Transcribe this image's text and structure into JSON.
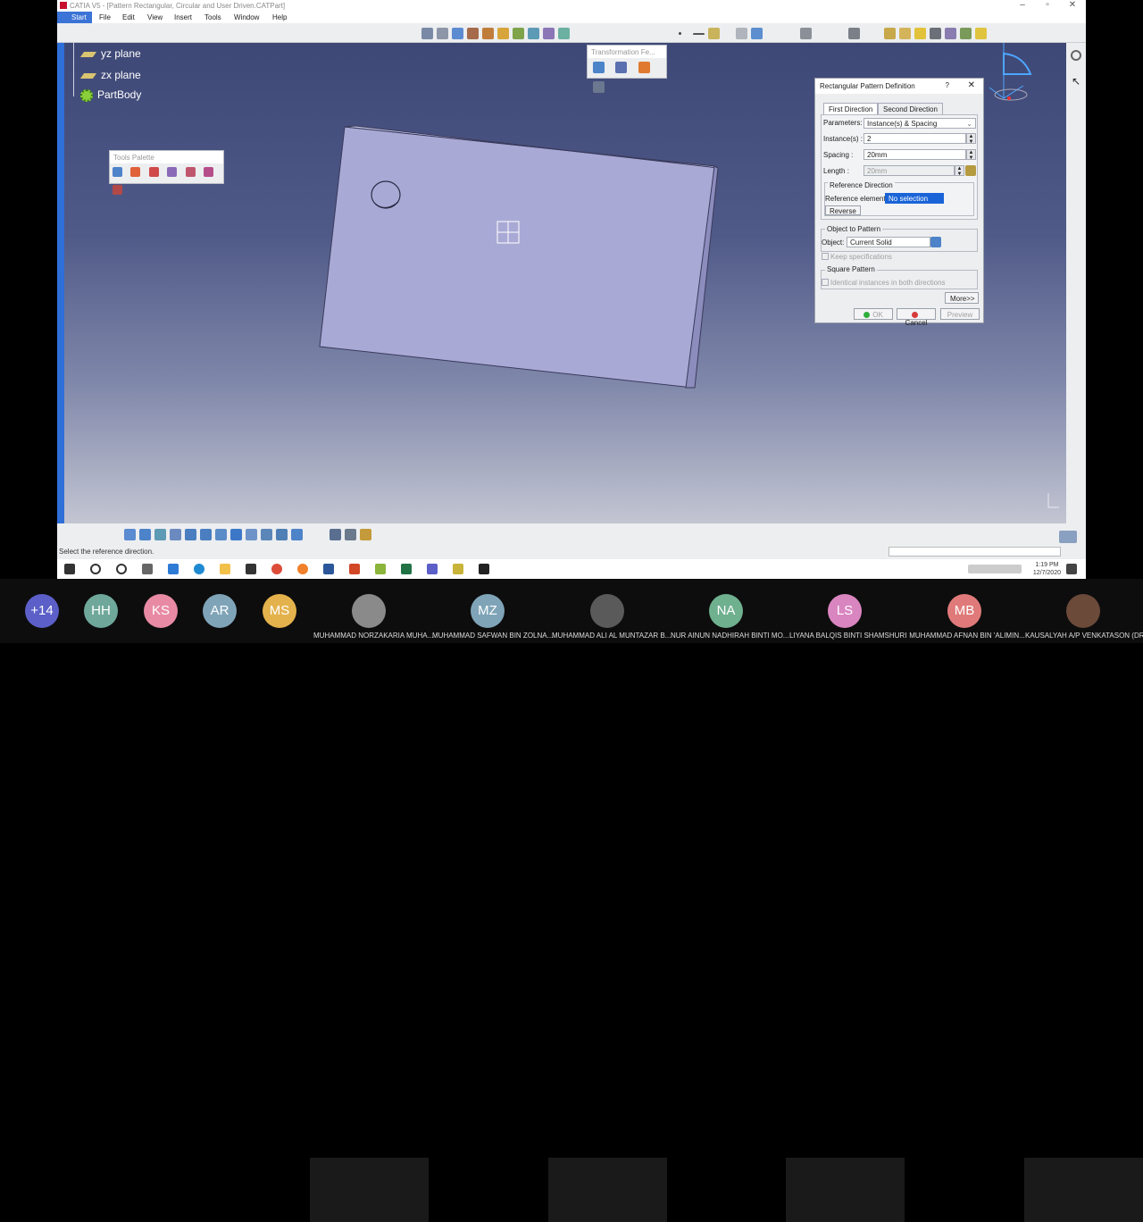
{
  "window": {
    "title": "CATIA V5 - [Pattern Rectangular, Circular and User Driven.CATPart]",
    "controls": [
      "–",
      "▫",
      "✕"
    ]
  },
  "menu": [
    "Start",
    "File",
    "Edit",
    "View",
    "Insert",
    "Tools",
    "Window",
    "Help"
  ],
  "tree": {
    "items": [
      {
        "label": "yz plane",
        "icon": "plane-icon"
      },
      {
        "label": "zx plane",
        "icon": "plane-icon"
      },
      {
        "label": "PartBody",
        "icon": "partbody-gear-icon"
      }
    ]
  },
  "tools_palette": {
    "title": "Tools Palette"
  },
  "transformation_toolbar": {
    "title": "Transformation Fe..."
  },
  "dialog": {
    "title": "Rectangular Pattern Definition",
    "help": "?",
    "close": "✕",
    "tabs": [
      "First Direction",
      "Second Direction"
    ],
    "parameters_label": "Parameters:",
    "parameters_value": "Instance(s) & Spacing",
    "instances_label": "Instance(s) :",
    "instances_value": "2",
    "spacing_label": "Spacing :",
    "spacing_value": "20mm",
    "length_label": "Length :",
    "length_value": "20mm",
    "reference_direction_group": "Reference Direction",
    "reference_element_label": "Reference element:",
    "reference_element_value": "No selection",
    "reverse_label": "Reverse",
    "object_group": "Object to Pattern",
    "object_label": "Object:",
    "object_value": "Current Solid",
    "keep_specifications": "Keep specifications",
    "square_group": "Square Pattern",
    "identical_instances": "Identical instances in both directions",
    "more_label": "More>>",
    "ok_label": "OK",
    "cancel_label": "Cancel",
    "preview_label": "Preview"
  },
  "status": {
    "message": "Select the reference direction."
  },
  "taskbar": {
    "time": "1:19 PM",
    "date": "12/7/2020"
  },
  "participants": [
    {
      "initials": "+14",
      "color": "#5b5fc7"
    },
    {
      "initials": "HH",
      "color": "#6fa89a"
    },
    {
      "initials": "KS",
      "color": "#e88aa4"
    },
    {
      "initials": "AR",
      "color": "#7fa4b8"
    },
    {
      "initials": "MS",
      "color": "#e4b24c"
    },
    {
      "initials": "",
      "name": "MUHAMMAD NORZAKARIA MUHA...",
      "color": "#666"
    },
    {
      "initials": "MZ",
      "name": "MUHAMMAD SAFWAN BIN ZOLNA...",
      "color": "#7fa4b8"
    },
    {
      "initials": "",
      "name": "MUHAMMAD ALI AL MUNTAZAR B...",
      "color": "#555"
    },
    {
      "initials": "NA",
      "name": "NUR AINUN NADHIRAH BINTI MO...",
      "color": "#6fb08f"
    },
    {
      "initials": "LS",
      "name": "LIYANA BALQIS BINTI SHAMSHURI",
      "color": "#d985c0"
    },
    {
      "initials": "MB",
      "name": "MUHAMMAD AFNAN BIN 'ALIMIN...",
      "color": "#e07a7a"
    },
    {
      "initials": "",
      "name": "KAUSALYAH A/P VENKATASON (DR.)",
      "color": "#444"
    }
  ]
}
